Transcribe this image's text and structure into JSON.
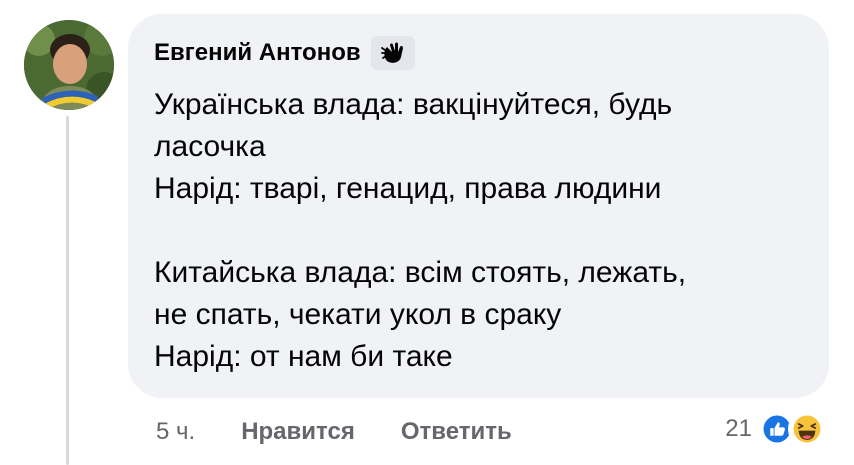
{
  "comment": {
    "author": "Евгений Антонов",
    "badge_icon": "waving-hand-icon",
    "lines": [
      "Українська влада: вакцінуйтеся, будь",
      "ласочка",
      "Нарід: тварі, генацид, права людини",
      "",
      "Китайська влада: всім стоять, лежать,",
      "не спать, чекати укол в сраку",
      "Нарід: от нам би таке"
    ]
  },
  "actions": {
    "time": "5 ч.",
    "like_label": "Нравится",
    "reply_label": "Ответить"
  },
  "reactions": {
    "count": "21",
    "icons": [
      "like-icon",
      "haha-icon"
    ]
  },
  "colors": {
    "bubble": "#f0f2f5",
    "text": "#050505",
    "muted": "#65676b",
    "like_blue": "#1b74e4",
    "haha_yellow": "#f7c33a"
  }
}
